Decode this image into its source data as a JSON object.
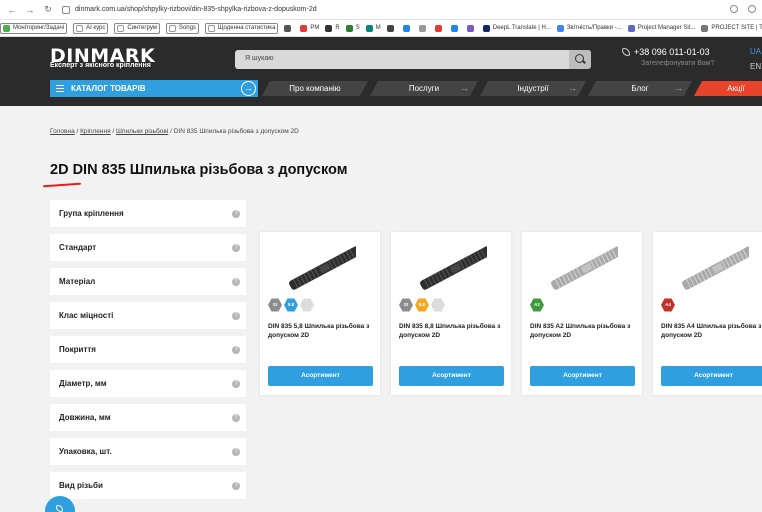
{
  "browser": {
    "url": "dinmark.com.ua/shop/shpylky-rizbovi/din-835-shpylka-rizbova-z-dopuskom-2d",
    "bookmarks": [
      {
        "label": "Моніторинг/Задачі",
        "color": "#4caf50",
        "boxed": true
      },
      {
        "label": "AI курс",
        "color": "#ffffff",
        "boxed": true
      },
      {
        "label": "Синтегрум",
        "color": "#ffffff",
        "boxed": true
      },
      {
        "label": "Songs",
        "color": "#ffffff",
        "boxed": true
      },
      {
        "label": "Щоденна статистика",
        "color": "#ffffff",
        "boxed": true
      },
      {
        "label": "",
        "color": "#555555",
        "boxed": false
      },
      {
        "label": "PM",
        "color": "#e53935",
        "boxed": false
      },
      {
        "label": "R",
        "color": "#333333",
        "boxed": false
      },
      {
        "label": "S",
        "color": "#2e7d32",
        "boxed": false
      },
      {
        "label": "M",
        "color": "#00897b",
        "boxed": false
      },
      {
        "label": "",
        "color": "#444444",
        "boxed": false
      },
      {
        "label": "",
        "color": "#1e88e5",
        "boxed": false
      },
      {
        "label": "",
        "color": "#999999",
        "boxed": false
      },
      {
        "label": "",
        "color": "#e53935",
        "boxed": false
      },
      {
        "label": "",
        "color": "#1e88e5",
        "boxed": false
      },
      {
        "label": "",
        "color": "#7e57c2",
        "boxed": false
      },
      {
        "label": "DeepL Translate | Н...",
        "color": "#0d2b5c",
        "boxed": false
      },
      {
        "label": "Звітність/Правки -...",
        "color": "#4285f4",
        "boxed": false
      },
      {
        "label": "Project Manager Sit...",
        "color": "#5c6bc0",
        "boxed": false
      },
      {
        "label": "PROJECT SITE | T",
        "color": "#777777",
        "boxed": false
      }
    ]
  },
  "header": {
    "logo": "DINMARK",
    "tagline": "Експерт з якісного кріплення",
    "search_placeholder": "Я шукаю",
    "phone": "+38 096 011-01-03",
    "callback": "Зателефонувати Вам?",
    "lang_active": "UA",
    "lang_other": "EN"
  },
  "menu": {
    "catalog": "КАТАЛОГ ТОВАРІВ",
    "items": [
      "Про компанію",
      "Послуги",
      "Індустрії",
      "Блог",
      "Акції"
    ]
  },
  "breadcrumb": [
    "Головна",
    "Кріплення",
    "Шпильки різьбові",
    "DIN 835 Шпилька різьбова з допуском 2D"
  ],
  "page_title": "2D DIN 835 Шпилька різьбова з допуском",
  "filters": [
    "Група кріплення",
    "Стандарт",
    "Матеріал",
    "Клас міцності",
    "Покриття",
    "Діаметр, мм",
    "Довжина, мм",
    "Упаковка, шт.",
    "Вид різьби"
  ],
  "filter_help": "?",
  "products": [
    {
      "name": "DIN 835 5,8 Шпилька різьбова з допуском 2D",
      "button": "Асортимент",
      "finish": "dark",
      "badges": [
        {
          "text": "St",
          "color": "#8c8c8c"
        },
        {
          "text": "5.8",
          "color": "#2f9fe0"
        },
        {
          "text": "",
          "color": "#dcdcdc"
        }
      ]
    },
    {
      "name": "DIN 835 8,8 Шпилька різьбова з допуском 2D",
      "button": "Асортимент",
      "finish": "dark",
      "badges": [
        {
          "text": "St",
          "color": "#8c8c8c"
        },
        {
          "text": "8.8",
          "color": "#f5a623"
        },
        {
          "text": "",
          "color": "#dcdcdc"
        }
      ]
    },
    {
      "name": "DIN 835 A2 Шпилька різьбова з допуском 2D",
      "button": "Асортимент",
      "finish": "steel",
      "badges": [
        {
          "text": "A2",
          "color": "#3f9b3a"
        }
      ]
    },
    {
      "name": "DIN 835 A4 Шпилька різьбова з допуском 2D",
      "button": "Асортимент",
      "finish": "steel",
      "badges": [
        {
          "text": "A4",
          "color": "#c4302b"
        }
      ]
    }
  ]
}
